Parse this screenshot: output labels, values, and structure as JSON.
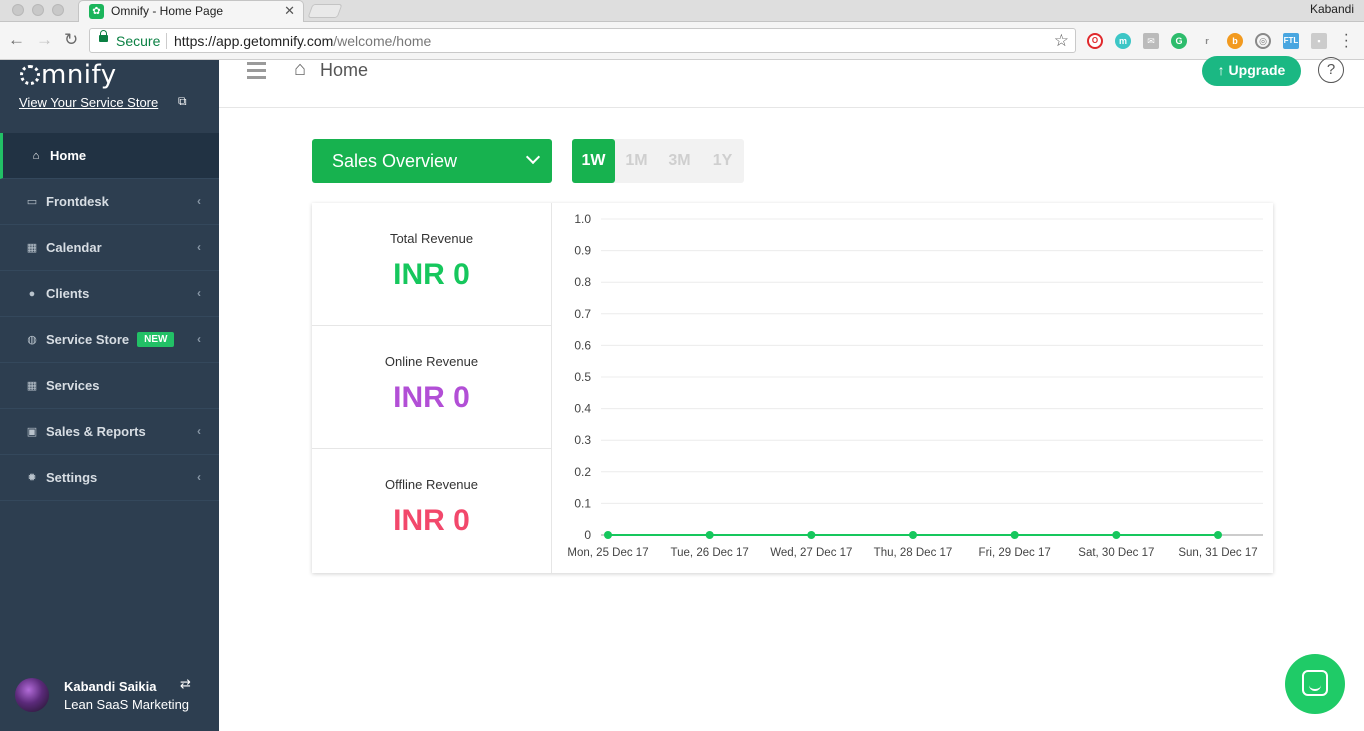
{
  "browser": {
    "tab_title": "Omnify - Home Page",
    "os_user": "Kabandi",
    "secure_label": "Secure",
    "url_base": "https://app.getomnify.com",
    "url_path": "/welcome/home"
  },
  "sidebar": {
    "logo_text": "mnify",
    "store_link": "View Your Service Store",
    "items": [
      {
        "label": "Home",
        "icon": "home-icon",
        "active": true
      },
      {
        "label": "Frontdesk",
        "icon": "monitor-icon"
      },
      {
        "label": "Calendar",
        "icon": "calendar-icon"
      },
      {
        "label": "Clients",
        "icon": "user-icon"
      },
      {
        "label": "Service Store",
        "icon": "globe-icon",
        "badge": "NEW"
      },
      {
        "label": "Services",
        "icon": "grid-icon"
      },
      {
        "label": "Sales & Reports",
        "icon": "money-icon"
      },
      {
        "label": "Settings",
        "icon": "gear-icon"
      }
    ],
    "user_name": "Kabandi Saikia",
    "user_org": "Lean SaaS Marketing"
  },
  "header": {
    "title": "Home",
    "upgrade_label": "Upgrade",
    "help_label": "?"
  },
  "controls": {
    "overview_select": "Sales Overview",
    "periods": [
      "1W",
      "1M",
      "3M",
      "1Y"
    ],
    "active_period": "1W"
  },
  "revenue": [
    {
      "label": "Total Revenue",
      "value": "INR 0",
      "color": "#16c75d"
    },
    {
      "label": "Online Revenue",
      "value": "INR 0",
      "color": "#b24fd6"
    },
    {
      "label": "Offline Revenue",
      "value": "INR 0",
      "color": "#f2486b"
    }
  ],
  "colors": {
    "brand_green": "#17b24f",
    "sidebar_bg": "#2d3e50",
    "line_color": "#16c75d"
  },
  "chart_data": {
    "type": "line",
    "categories": [
      "Mon, 25 Dec 17",
      "Tue, 26 Dec 17",
      "Wed, 27 Dec 17",
      "Thu, 28 Dec 17",
      "Fri, 29 Dec 17",
      "Sat, 30 Dec 17",
      "Sun, 31 Dec 17"
    ],
    "series": [
      {
        "values": [
          0,
          0,
          0,
          0,
          0,
          0,
          0
        ]
      }
    ],
    "y_ticks": [
      "0",
      "0.1",
      "0.2",
      "0.3",
      "0.4",
      "0.5",
      "0.6",
      "0.7",
      "0.8",
      "0.9",
      "1.0"
    ],
    "ylim": [
      0,
      1.0
    ],
    "grid": true
  }
}
